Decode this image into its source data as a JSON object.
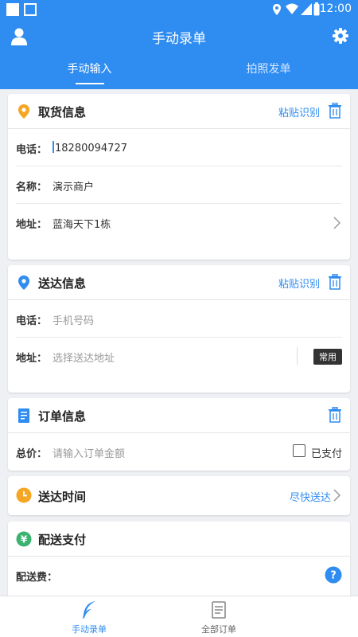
{
  "status_bar": {
    "time": "12:00"
  },
  "header": {
    "title": "手动录单",
    "tabs": [
      {
        "label": "手动输入",
        "active": true
      },
      {
        "label": "拍照发单",
        "active": false
      }
    ]
  },
  "pickup": {
    "title": "取货信息",
    "paste_label": "粘贴识别",
    "phone_label": "电话：",
    "phone_value": "18280094727",
    "name_label": "名称：",
    "name_value": "演示商户",
    "address_label": "地址：",
    "address_value": "蓝海天下1栋"
  },
  "delivery": {
    "title": "送达信息",
    "paste_label": "粘贴识别",
    "phone_label": "电话：",
    "phone_placeholder": "手机号码",
    "address_label": "地址：",
    "address_placeholder": "选择送达地址",
    "common_label": "常用"
  },
  "order": {
    "title": "订单信息",
    "total_label": "总价：",
    "total_placeholder": "请输入订单金额",
    "paid_label": "已支付"
  },
  "delivery_time": {
    "title": "送达时间",
    "value": "尽快送达"
  },
  "payment": {
    "title": "配送支付",
    "fee_label": "配送费：",
    "yuan_symbol": "¥",
    "help_symbol": "?"
  },
  "bottom_nav": {
    "items": [
      {
        "label": "手动录单",
        "active": true
      },
      {
        "label": "全部订单",
        "active": false
      }
    ]
  },
  "colors": {
    "accent": "#2f8cf0",
    "pickup_icon": "#f5a623",
    "order_icon": "#2f8cf0",
    "time_icon": "#f5a623",
    "pay_icon": "#3cb371"
  }
}
